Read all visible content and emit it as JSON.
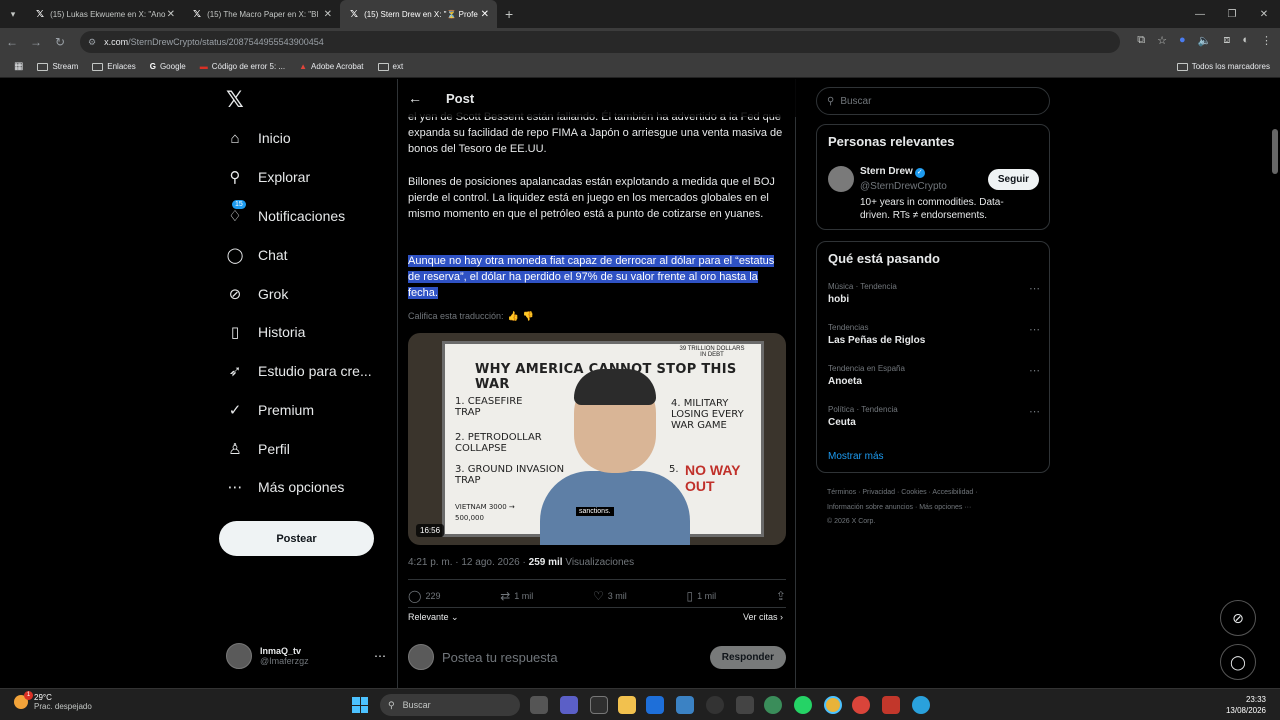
{
  "browser": {
    "tabs": [
      {
        "label": "(15) Lukas Ekwueme en X: \"Ano"
      },
      {
        "label": "(15) The Macro Paper en X: \"Bl"
      },
      {
        "label": "(15) Stern Drew en X: \"⏳ Profe"
      }
    ],
    "url_prefix": "x.com",
    "url_path": "/SternDrewCrypto/status/2087544955543900454",
    "bookmarks": [
      "Stream",
      "Enlaces",
      "Google",
      "Código de error 5: ...",
      "Adobe Acrobat",
      "ext"
    ],
    "all_bookmarks": "Todos los marcadores"
  },
  "nav": {
    "items": [
      {
        "label": "Inicio",
        "icon": "home-icon"
      },
      {
        "label": "Explorar",
        "icon": "search-icon"
      },
      {
        "label": "Notificaciones",
        "icon": "bell-icon",
        "badge": "15"
      },
      {
        "label": "Chat",
        "icon": "chat-icon"
      },
      {
        "label": "Grok",
        "icon": "grok-icon"
      },
      {
        "label": "Historia",
        "icon": "bookmark-icon"
      },
      {
        "label": "Estudio para cre...",
        "icon": "rocket-icon"
      },
      {
        "label": "Premium",
        "icon": "verified-icon"
      },
      {
        "label": "Perfil",
        "icon": "person-icon"
      },
      {
        "label": "Más opciones",
        "icon": "more-icon"
      }
    ],
    "post_button": "Postear",
    "account": {
      "name": "InmaQ_tv",
      "handle": "@Imaferzgz"
    }
  },
  "post": {
    "header": "Post",
    "para1": "el yen de Scott Bessent están fallando. Él también ha advertido a la Fed que expanda su facilidad de repo FIMA a Japón o arriesgue una venta masiva de bonos del Tesoro de EE.UU.",
    "para2": "Billones de posiciones apalancadas están explotando a medida que el BOJ pierde el control. La liquidez está en juego en los mercados globales en el mismo momento en que el petróleo está a punto de cotizarse en yuanes.",
    "para3": "Aunque no hay otra moneda fiat capaz de derrocar al dólar para el “estatus de reserva”, el dólar ha perdido el 97% de su valor frente al oro hasta la fecha.",
    "rate_translation": "Califica esta traducción:",
    "video": {
      "title": "WHY AMERICA CANNOT STOP THIS WAR",
      "debt_note": "39 TRILLION DOLLARS IN DEBT",
      "item1": "1. CEASEFIRE TRAP",
      "item2": "2. PETRODOLLAR COLLAPSE",
      "item3": "3. GROUND INVASION TRAP",
      "item4": "4. MILITARY LOSING EVERY WAR GAME",
      "item5": "5.",
      "no_way_out": "NO WAY OUT",
      "vietnam": "VIETNAM 3000 → 500,000",
      "caption": "sanctions.",
      "duration": "16:56"
    },
    "meta_time": "4:21 p. m. · 12 ago. 2026 · ",
    "meta_views": "259 mil",
    "meta_views_label": " Visualizaciones",
    "actions": {
      "replies": "229",
      "reposts": "1 mil",
      "likes": "3 mil",
      "bookmarks": "1 mil"
    },
    "sort_label": "Relevante",
    "quotes_link": "Ver citas",
    "reply_placeholder": "Postea tu respuesta",
    "reply_button": "Responder"
  },
  "sidebar": {
    "search_placeholder": "Buscar",
    "relevant_title": "Personas relevantes",
    "person": {
      "name": "Stern Drew",
      "handle": "@SternDrewCrypto",
      "bio": "10+ years in commodities. Data-driven. RTs ≠ endorsements.",
      "follow": "Seguir"
    },
    "trends_title": "Qué está pasando",
    "trends": [
      {
        "category": "Música · Tendencia",
        "name": "hobi"
      },
      {
        "category": "Tendencias",
        "name": "Las Peñas de Riglos"
      },
      {
        "category": "Tendencia en España",
        "name": "Anoeta"
      },
      {
        "category": "Política · Tendencia",
        "name": "Ceuta"
      }
    ],
    "show_more": "Mostrar más",
    "footer_line1": "Términos · Privacidad · Cookies · Accesibilidad ·",
    "footer_line2": "Información sobre anuncios · Más opciones ···",
    "footer_line3": "© 2026 X Corp."
  },
  "taskbar": {
    "temp": "29°C",
    "condition": "Prac. despejado",
    "weather_badge": "1",
    "search": "Buscar",
    "time": "23:33",
    "date": "13/08/2026"
  }
}
